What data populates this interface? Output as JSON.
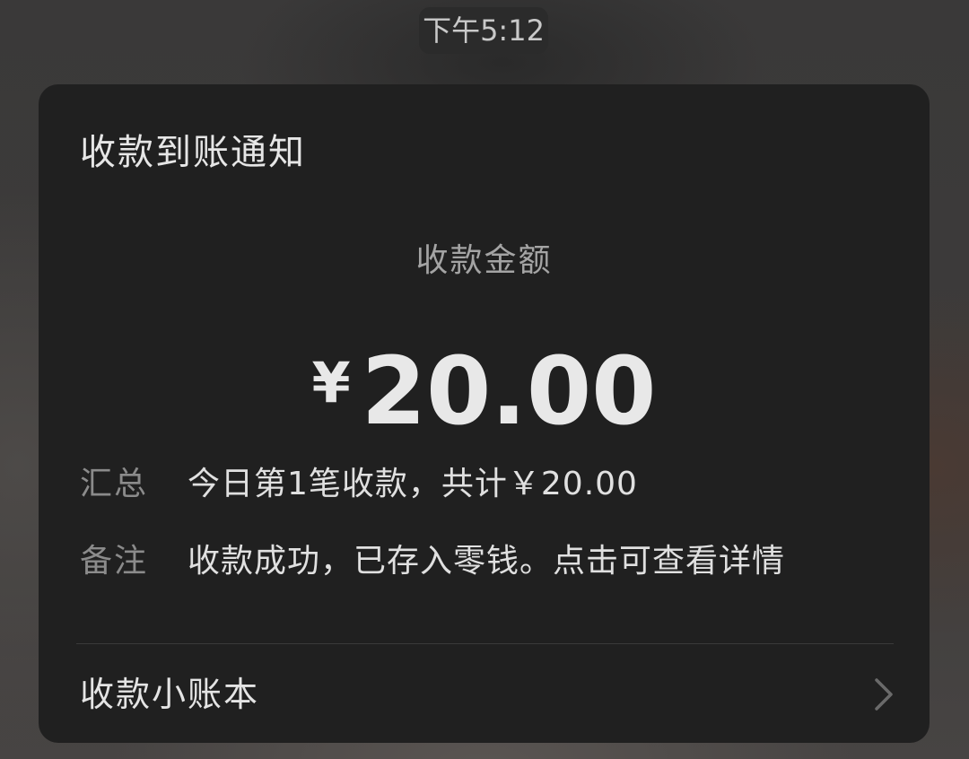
{
  "status_bar": {
    "time": "下午5:12"
  },
  "notification": {
    "title": "收款到账通知",
    "amount_label": "收款金额",
    "currency_symbol": "¥",
    "amount": "20.00",
    "summary": {
      "label": "汇总",
      "value": "今日第1笔收款，共计￥20.00"
    },
    "note": {
      "label": "备注",
      "value": "收款成功，已存入零钱。点击可查看详情"
    },
    "footer": {
      "label": "收款小账本",
      "icon": "chevron-right-icon"
    }
  },
  "colors": {
    "card_background": "#202020",
    "text_primary": "#e6e6e6",
    "text_secondary": "#8b8b8b"
  }
}
